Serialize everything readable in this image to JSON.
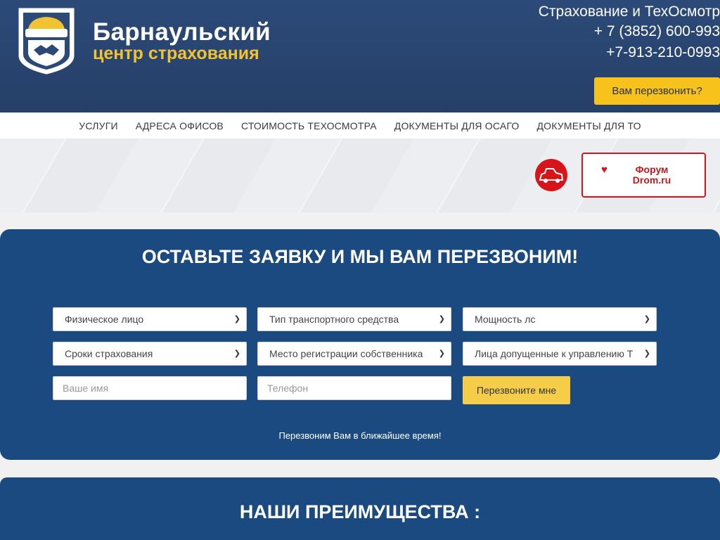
{
  "header": {
    "brand_line1": "Барнаульский",
    "brand_line2": "центр страхования",
    "contact_title": "Страхование и ТехОсмотр",
    "phone1": "+ 7 (3852) 600-993",
    "phone2": "+7-913-210-0993",
    "callback_label": "Вам перезвонить?"
  },
  "nav": {
    "items": [
      "Услуги",
      "Адреса офисов",
      "Стоимость техосмотра",
      "Документы для ОСАГО",
      "Документы для ТО"
    ]
  },
  "banner": {
    "forum_label": "Форум Drom.ru"
  },
  "form": {
    "title": "ОСТАВЬТЕ ЗАЯВКУ И МЫ ВАМ ПЕРЕЗВОНИМ!",
    "selects": [
      "Физическое лицо",
      "Тип транспортного средства",
      "Мощность лс",
      "Сроки страхования",
      "Место регистрации собственника",
      "Лица допущенные к управлению Т"
    ],
    "name_placeholder": "Ваше имя",
    "phone_placeholder": "Телефон",
    "submit_label": "Перезвоните мне",
    "note": "Перезвоним Вам в ближайшее время!"
  },
  "advantages": {
    "title": "НАШИ ПРЕИМУЩЕСТВА :"
  },
  "colors": {
    "header_bg": "#2c4a78",
    "accent_yellow": "#f7c21b",
    "form_bg": "#1a4a80",
    "drom_red": "#d7141a"
  }
}
